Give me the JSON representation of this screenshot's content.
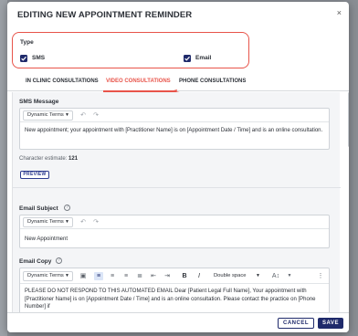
{
  "modal": {
    "title": "EDITING NEW APPOINTMENT REMINDER",
    "close": "×"
  },
  "type": {
    "label": "Type",
    "sms_label": "SMS",
    "email_label": "Email",
    "sms_checked": true,
    "email_checked": true
  },
  "tabs": [
    {
      "label": "IN CLINIC CONSULTATIONS"
    },
    {
      "label": "VIDEO CONSULTATIONS",
      "active": true
    },
    {
      "label": "PHONE CONSULTATIONS"
    }
  ],
  "sms": {
    "label": "SMS Message",
    "dropdown": "Dynamic Terms",
    "text": "New appointment; your appointment with [Practitioner Name] is on [Appointment Date / Time] and is an online consultation.",
    "char_label": "Character estimate:",
    "char_count": "121",
    "preview": "PREVIEW"
  },
  "email_subject": {
    "label": "Email Subject",
    "dropdown": "Dynamic Terms",
    "text": "New Appointment"
  },
  "email_copy": {
    "label": "Email Copy",
    "dropdown": "Dynamic Terms",
    "spacing": "Double space",
    "text": "PLEASE DO NOT RESPOND TO THIS AUTOMATED EMAIL Dear [Patient Legal Full Name], Your appointment with [Practitioner Name] is on [Appointment Date / Time] and is an online consultation. Please contact the practice on [Phone Number] if"
  },
  "footer": {
    "cancel": "CANCEL",
    "save": "SAVE"
  },
  "colors": {
    "accent": "#e8544a",
    "primary": "#1f2a6b"
  }
}
